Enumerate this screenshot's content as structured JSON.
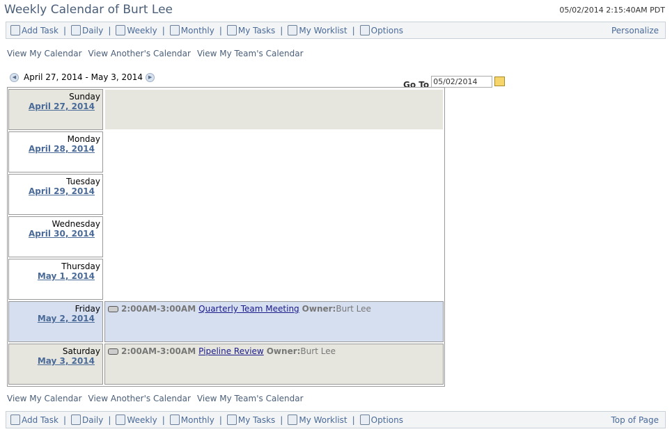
{
  "header": {
    "title": "Weekly Calendar of Burt Lee",
    "datetime": "05/02/2014 2:15:40AM PDT"
  },
  "toolbar": {
    "items": [
      {
        "label": "Add Task",
        "icon": "add-task-icon"
      },
      {
        "label": "Daily",
        "icon": "daily-calendar-icon"
      },
      {
        "label": "Weekly",
        "icon": "weekly-calendar-icon"
      },
      {
        "label": "Monthly",
        "icon": "monthly-calendar-icon"
      },
      {
        "label": "My Tasks",
        "icon": "tasks-icon"
      },
      {
        "label": "My Worklist",
        "icon": "worklist-icon"
      },
      {
        "label": "Options",
        "icon": "options-icon"
      }
    ],
    "personalize": "Personalize",
    "top_of_page": "Top of Page"
  },
  "views": [
    "View My Calendar",
    "View Another's Calendar",
    "View My Team's Calendar"
  ],
  "range": "April 27, 2014 - May 3, 2014",
  "goto": {
    "label": "Go To",
    "value": "05/02/2014"
  },
  "colors": {
    "weekend": "#e6e6de",
    "today": "#d6dff0",
    "weekday": "#ffffff"
  },
  "days": [
    {
      "weekday": "Sunday",
      "date": "April 27, 2014",
      "type": "weekend",
      "events": []
    },
    {
      "weekday": "Monday",
      "date": "April 28, 2014",
      "type": "weekday",
      "events": []
    },
    {
      "weekday": "Tuesday",
      "date": "April 29, 2014",
      "type": "weekday",
      "events": []
    },
    {
      "weekday": "Wednesday",
      "date": "April 30, 2014",
      "type": "weekday",
      "events": []
    },
    {
      "weekday": "Thursday",
      "date": "May 1, 2014",
      "type": "weekday",
      "events": []
    },
    {
      "weekday": "Friday",
      "date": "May 2, 2014",
      "type": "today",
      "events": [
        {
          "time": "2:00AM-3:00AM",
          "title": "Quarterly Team Meeting",
          "owner_label": "Owner:",
          "owner": "Burt Lee"
        }
      ]
    },
    {
      "weekday": "Saturday",
      "date": "May 3, 2014",
      "type": "weekend",
      "events": [
        {
          "time": "2:00AM-3:00AM",
          "title": "Pipeline Review",
          "owner_label": "Owner:",
          "owner": "Burt Lee"
        }
      ]
    }
  ]
}
